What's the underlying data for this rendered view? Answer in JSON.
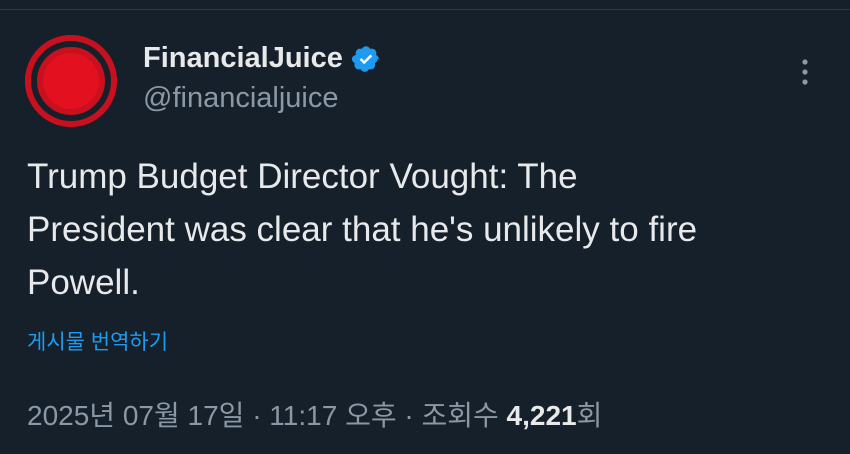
{
  "author": {
    "display_name": "FinancialJuice",
    "handle": "@financialjuice",
    "verified": true,
    "avatar_icon": "red-record-circle-logo",
    "avatar_color": "#c8101e"
  },
  "tweet": {
    "text": "Trump Budget Director Vought: The\nPresident was clear that he's unlikely to fire\nPowell.",
    "translate_label": "게시물 번역하기"
  },
  "meta": {
    "timestamp": "2025년 07월 17일 · 11:17 오후 · 조회수 ",
    "views_count": "4,221",
    "views_suffix": "회"
  },
  "icons": {
    "verified": "verified-badge-icon",
    "more": "more-options-icon"
  },
  "colors": {
    "background": "#15202b",
    "accent": "#1d9bf0",
    "secondary_text": "#8b98a5"
  }
}
